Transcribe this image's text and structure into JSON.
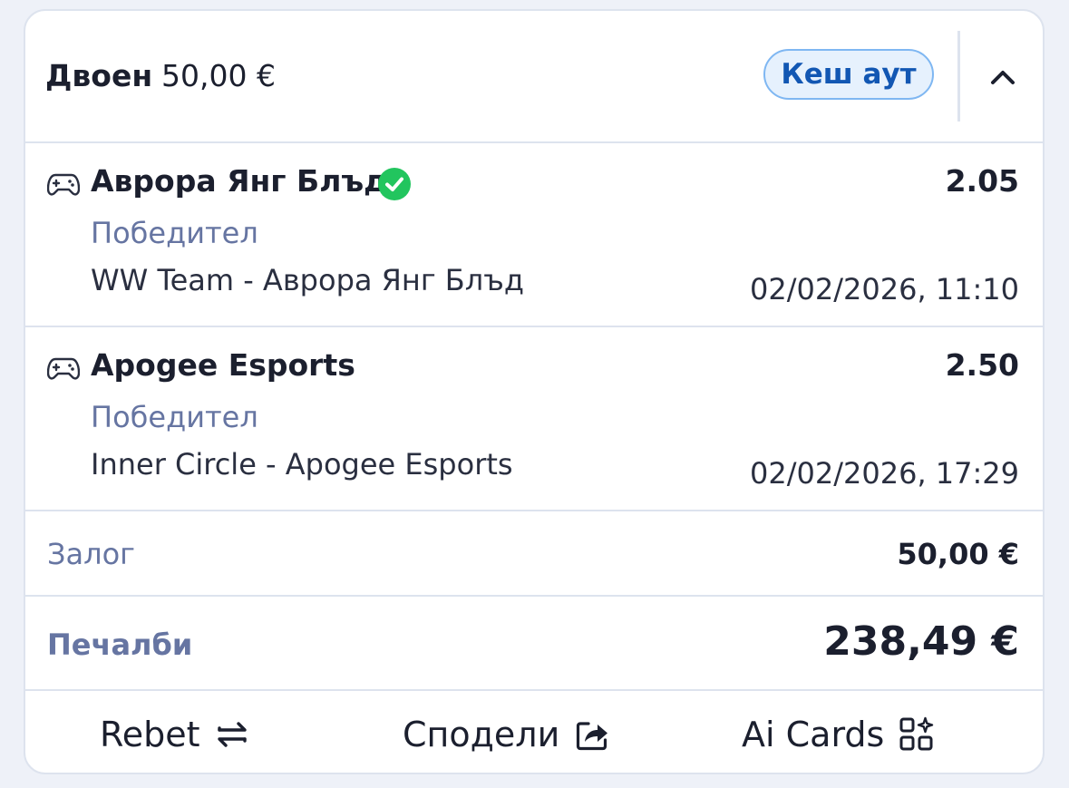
{
  "header": {
    "bet_type": "Двоен",
    "amount": "50,00 €",
    "cashout_label": "Кеш аут"
  },
  "selections": [
    {
      "name": "Аврора Янг Блъд",
      "odds": "2.05",
      "market": "Победител",
      "event": "WW Team - Аврора Янг Блъд",
      "date": "02/02/2026, 11:10",
      "status_icon": "check-circle-icon",
      "sport_icon": "gamepad-icon"
    },
    {
      "name": "Apogee Esports",
      "odds": "2.50",
      "market": "Победител",
      "event": "Inner Circle - Apogee Esports",
      "date": "02/02/2026, 17:29",
      "sport_icon": "gamepad-icon"
    }
  ],
  "stake": {
    "label": "Залог",
    "value": "50,00 €"
  },
  "winnings": {
    "label": "Печалби",
    "value": "238,49 €"
  },
  "actions": {
    "rebet": "Rebet",
    "share": "Сподели",
    "ai_cards": "Ai Cards"
  },
  "colors": {
    "accent": "#1257b3",
    "muted": "#6675a2",
    "success": "#22c55e",
    "border": "#dde3ee"
  }
}
